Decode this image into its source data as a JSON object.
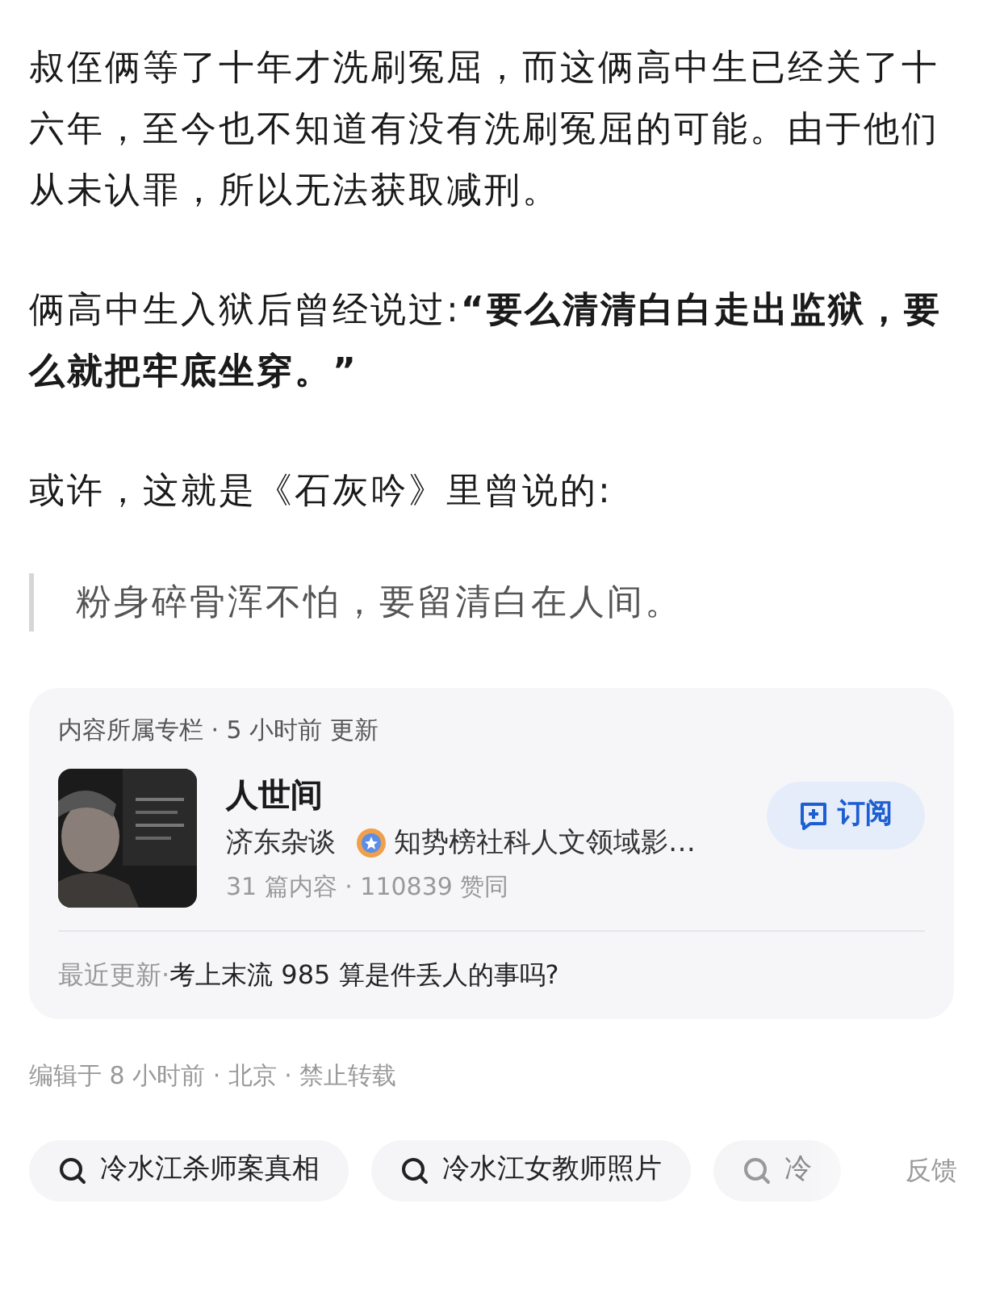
{
  "paragraphs": [
    "叔侄俩等了十年才洗刷冤屈，而这俩高中生已经关了十六年，至今也不知道有没有洗刷冤屈的可能。由于他们从未认罪，所以无法获取减刑。",
    "俩高中生入狱后曾经说过:**“要么清清白白走出监狱，要么就把牢底坐穿。”**",
    "或许，这就是《石灰吟》里曾说的:"
  ],
  "quote": "粉身碎骨浑不怕，要留清白在人间。",
  "column_card": {
    "header": "内容所属专栏 · 5 小时前 更新",
    "title": "人世间",
    "author": "济东杂谈",
    "badge": "知势榜社科人文领域影…",
    "stats": "31 篇内容 · 110839 赞同",
    "subscribe_button": "订阅",
    "latest_label": "最近更新",
    "latest_separator": "·",
    "latest_title": "考上末流 985 算是件丢人的事吗?"
  },
  "meta": "编辑于 8 小时前 · 北京 · 禁止转载",
  "search_chips": [
    {
      "label": "冷水江杀师案真相",
      "faded": false
    },
    {
      "label": "冷水江女教师照片",
      "faded": false
    },
    {
      "label": "冷",
      "faded": true
    }
  ],
  "feedback": "反馈"
}
